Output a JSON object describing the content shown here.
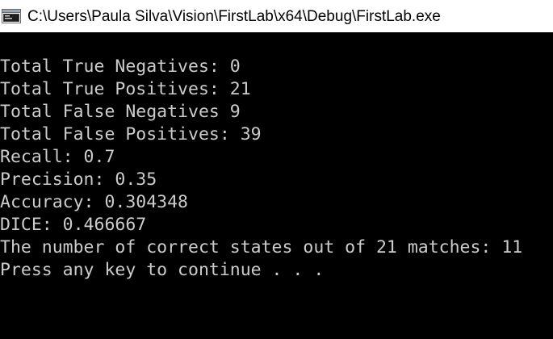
{
  "window": {
    "title": "C:\\Users\\Paula Silva\\Vision\\FirstLab\\x64\\Debug\\FirstLab.exe",
    "icon": "console-app-icon"
  },
  "console": {
    "lines": [
      "Total True Negatives: 0",
      "Total True Positives: 21",
      "Total False Negatives 9",
      "Total False Positives: 39",
      "Recall: 0.7",
      "Precision: 0.35",
      "Accuracy: 0.304348",
      "DICE: 0.466667",
      "The number of correct states out of 21 matches: 11",
      "Press any key to continue . . ."
    ]
  },
  "colors": {
    "console_background": "#000000",
    "console_text": "#cccccc",
    "titlebar_background": "#ffffff",
    "titlebar_text": "#000000"
  }
}
